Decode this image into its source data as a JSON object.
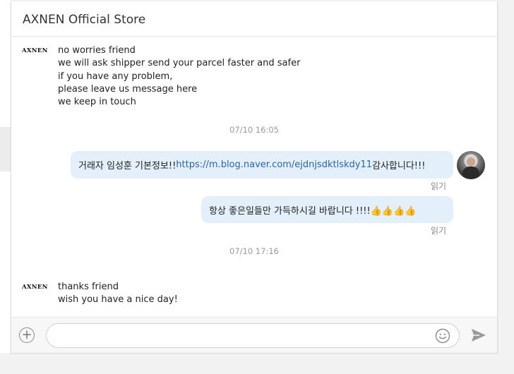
{
  "header": {
    "title": "AXNEN Official Store"
  },
  "store_logo_text": "AXNEN",
  "messages": {
    "m1": {
      "sender": "store",
      "lines": "no worries friend\nwe will ask shipper send your parcel faster and safer\nif you have any problem,\nplease leave us message here\nwe keep in touch"
    },
    "ts1": "07/10 16:05",
    "m2": {
      "sender": "user",
      "prefix": "거래자 임성훈 기본정보!! ",
      "link": "https://m.blog.naver.com/ejdnjsdktlskdy11",
      "suffix": "  감사합니다!!!",
      "status": "읽기"
    },
    "m3": {
      "sender": "user",
      "text": "항상 좋은일들만 가득하시길 바랍니다 !!!!👍👍👍👍",
      "status": "읽기"
    },
    "ts2": "07/10 17:16",
    "m4": {
      "sender": "store",
      "lines": "thanks friend\nwish you have a nice day!"
    }
  },
  "composer": {
    "value": "",
    "placeholder": ""
  },
  "icons": {
    "add": "plus-circle-icon",
    "emoji": "smiley-icon",
    "send": "send-arrow-icon"
  },
  "colors": {
    "bubble_user": "#e3effa",
    "link": "#2a66a8",
    "timestamp": "#9a9a9a"
  }
}
